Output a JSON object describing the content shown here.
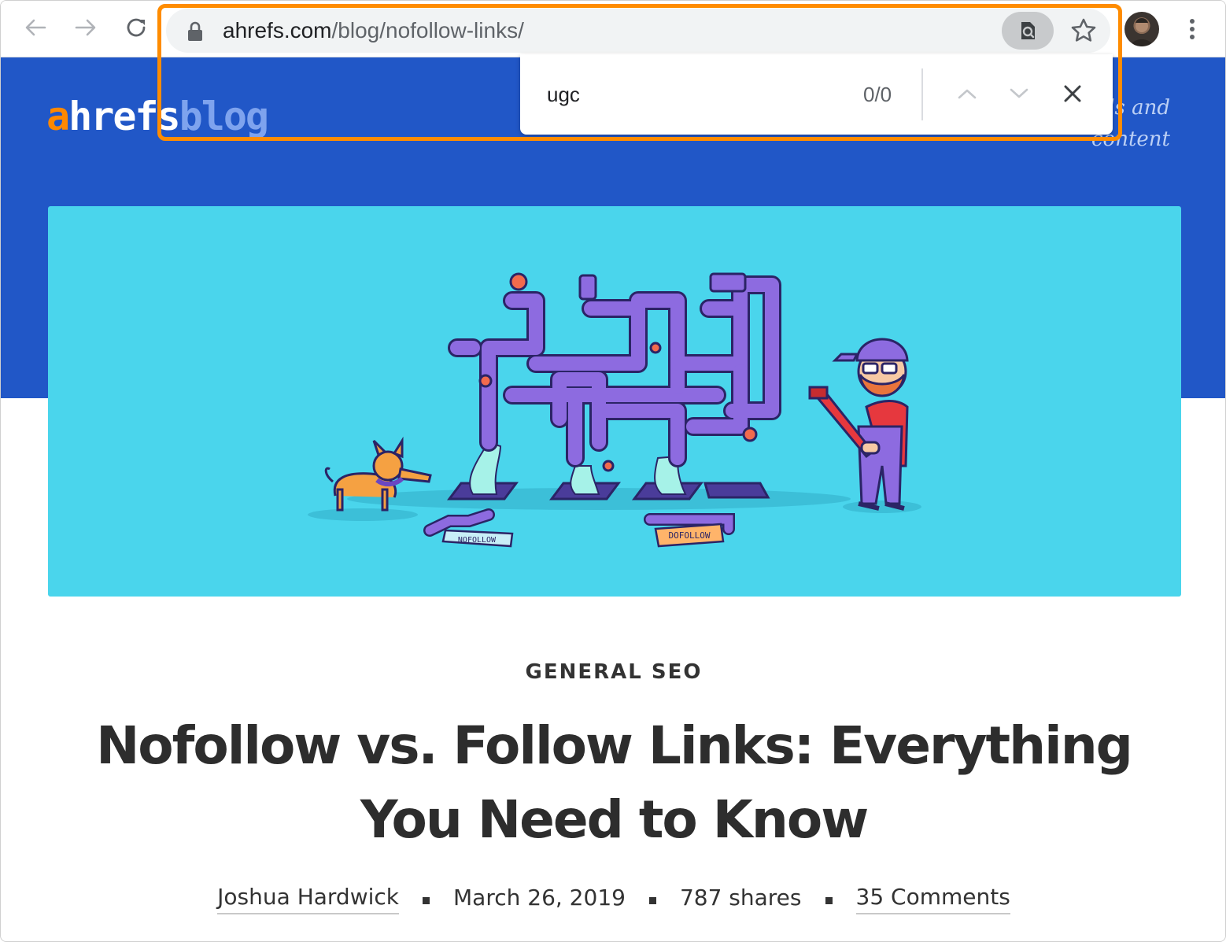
{
  "browser": {
    "url_domain": "ahrefs.com",
    "url_path": "/blog/nofollow-links/"
  },
  "find_bar": {
    "query": "ugc",
    "match_count": "0/0"
  },
  "site": {
    "logo_a": "a",
    "logo_rest": "hrefs",
    "logo_blog": "blog",
    "tagline": "...et powered by a huge index of backlinks, keywords and content"
  },
  "hero": {
    "sign_left": "NOFOLLOW",
    "sign_right": "DOFOLLOW"
  },
  "article": {
    "category": "GENERAL SEO",
    "title": "Nofollow vs. Follow Links: Everything You Need to Know",
    "author": "Joshua Hardwick",
    "date": "March 26, 2019",
    "shares": "787 shares",
    "comments": "35 Comments"
  },
  "colors": {
    "header_blue": "#2157c7",
    "hero_cyan": "#4ad5ec",
    "highlight_orange": "#ff8c00",
    "logo_orange": "#ff8800",
    "pipe_purple": "#8d6be0"
  }
}
